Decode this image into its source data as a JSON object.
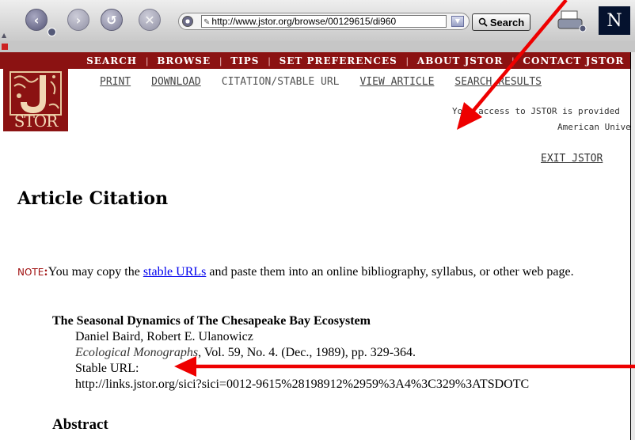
{
  "browser": {
    "url": "http://www.jstor.org/browse/00129615/di960",
    "search_label": "Search",
    "logo_letter": "N"
  },
  "site": {
    "logo_text": "STOR",
    "nav": [
      "SEARCH",
      "BROWSE",
      "TIPS",
      "SET PREFERENCES",
      "ABOUT JSTOR",
      "CONTACT JSTOR"
    ],
    "toplinks": {
      "print": "PRINT",
      "download": "DOWNLOAD",
      "citation": "CITATION/STABLE URL",
      "view_article": "VIEW ARTICLE",
      "search_results": "SEARCH RESULTS"
    },
    "access_line1": "Your access to JSTOR is provided",
    "access_line2": "American University",
    "exit": "EXIT JSTOR"
  },
  "page": {
    "heading": "Article Citation",
    "note_label": "NOTE",
    "note_before_link": "You may copy the ",
    "note_link": "stable URLs",
    "note_after_link": " and paste them into an online bibliography, syllabus, or other web page.",
    "citation": {
      "title": "The Seasonal Dynamics of The Chesapeake Bay Ecosystem",
      "authors": "Daniel Baird, Robert E. Ulanowicz",
      "journal": "Ecological Monographs",
      "details": ", Vol. 59, No. 4. (Dec., 1989), pp. 329-364.",
      "stable_label": "Stable URL:",
      "stable_url": "http://links.jstor.org/sici?sici=0012-9615%28198912%2959%3A4%3C329%3ATSDOTC"
    },
    "abstract_heading": "Abstract"
  },
  "colors": {
    "jstor_red": "#8b1212",
    "annotation_arrow": "#ee0000"
  }
}
